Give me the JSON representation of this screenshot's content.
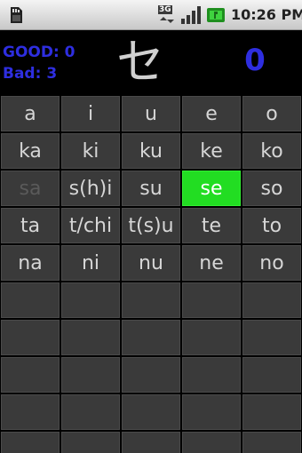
{
  "status_bar": {
    "network_label": "3G",
    "time": "10:26 PM",
    "icons": [
      "sd-card-icon",
      "network-3g-icon",
      "signal-icon",
      "battery-icon"
    ]
  },
  "header": {
    "good_label": "GOOD: 0",
    "bad_label": "Bad: 3",
    "kana": "セ",
    "counter": "0"
  },
  "colors": {
    "score_text": "#2e2ee0",
    "cell_bg": "#3a3a3a",
    "highlight": "#22dd22",
    "dimmed_text": "#5a5a5a"
  },
  "grid": {
    "rows": [
      [
        "a",
        "i",
        "u",
        "e",
        "o"
      ],
      [
        "ka",
        "ki",
        "ku",
        "ke",
        "ko"
      ],
      [
        "sa",
        "s(h)i",
        "su",
        "se",
        "so"
      ],
      [
        "ta",
        "t/chi",
        "t(s)u",
        "te",
        "to"
      ],
      [
        "na",
        "ni",
        "nu",
        "ne",
        "no"
      ],
      [
        "",
        "",
        "",
        "",
        ""
      ],
      [
        "",
        "",
        "",
        "",
        ""
      ],
      [
        "",
        "",
        "",
        "",
        ""
      ],
      [
        "",
        "",
        "",
        "",
        ""
      ],
      [
        "",
        "",
        "",
        "",
        ""
      ]
    ],
    "highlighted": "se",
    "dimmed": [
      "sa"
    ]
  }
}
